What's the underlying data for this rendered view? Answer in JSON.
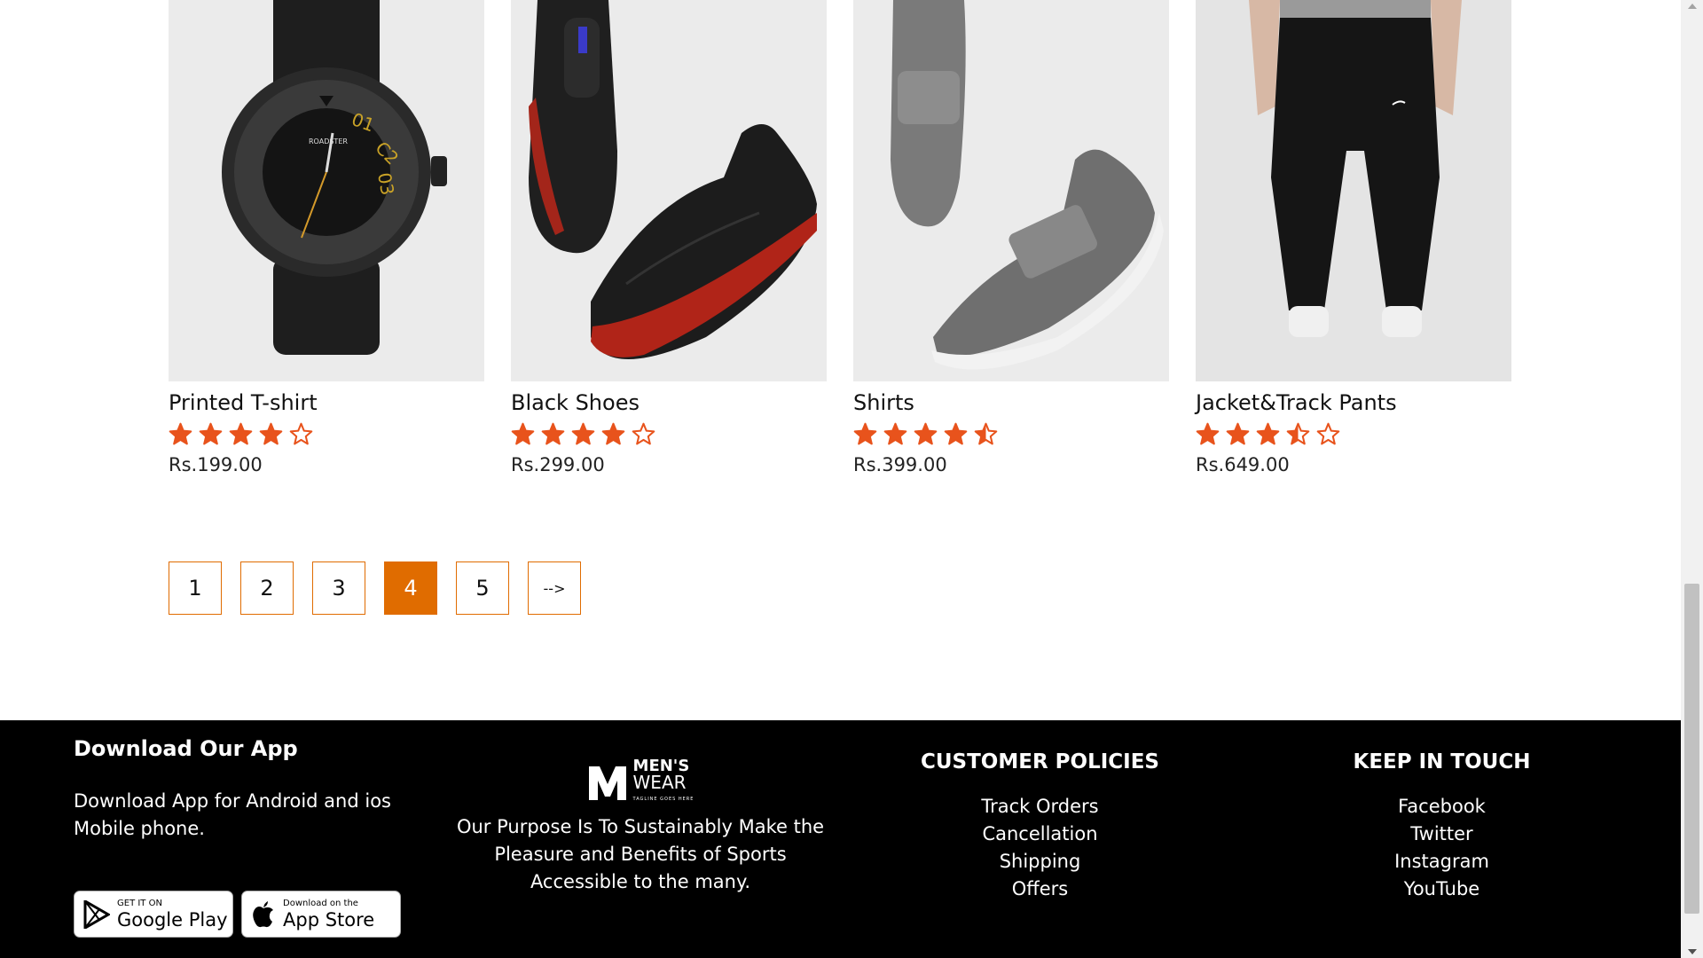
{
  "products": [
    {
      "name": "Printed T-shirt",
      "rating": 4,
      "rating_max": 5,
      "price": "Rs.199.00",
      "image_icon": "watch-image"
    },
    {
      "name": "Black Shoes",
      "rating": 4,
      "rating_max": 5,
      "price": "Rs.299.00",
      "image_icon": "shoes-image"
    },
    {
      "name": "Shirts",
      "rating": 4.5,
      "rating_max": 5,
      "price": "Rs.399.00",
      "image_icon": "slip-on-shoes-image"
    },
    {
      "name": "Jacket&Track Pants",
      "rating": 3.5,
      "rating_max": 5,
      "price": "Rs.649.00",
      "image_icon": "track-pants-image"
    }
  ],
  "pagination": {
    "pages": [
      "1",
      "2",
      "3",
      "4",
      "5"
    ],
    "current": "4",
    "next_label": "-->"
  },
  "footer": {
    "app": {
      "title": "Download Our App",
      "text": "Download App for Android and ios Mobile phone.",
      "google_play": {
        "small": "GET IT ON",
        "big": "Google Play"
      },
      "app_store": {
        "small": "Download on the",
        "big": "App Store"
      }
    },
    "brand": {
      "logo_line1": "MEN'S",
      "logo_line2": "WEAR",
      "logo_tagline": "TAGLINE GOES HERE",
      "text": "Our Purpose Is To Sustainably Make the Pleasure and Benefits of Sports Accessible to the many."
    },
    "policies": {
      "title": "CUSTOMER POLICIES",
      "links": [
        "Track Orders",
        "Cancellation",
        "Shipping",
        "Offers"
      ]
    },
    "touch": {
      "title": "KEEP IN TOUCH",
      "links": [
        "Facebook",
        "Twitter",
        "Instagram",
        "YouTube"
      ]
    }
  },
  "colors": {
    "accent": "#e06c00",
    "star": "#e8531c",
    "footer_bg": "#000000"
  }
}
